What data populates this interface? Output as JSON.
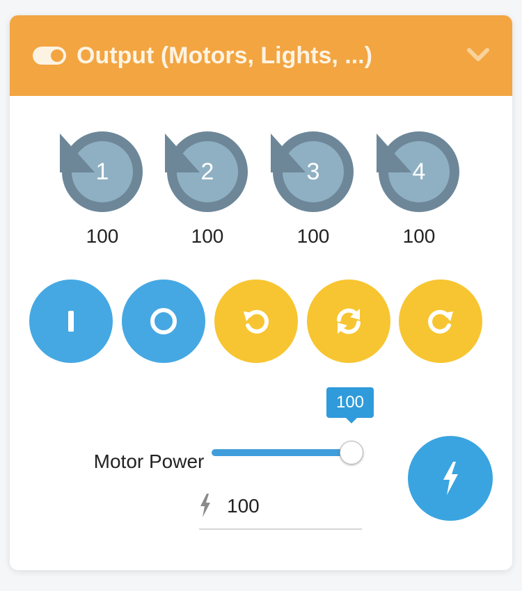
{
  "panel": {
    "title": "Output (Motors, Lights, ...)",
    "accent_color": "#f2a541",
    "icons": {
      "toggle": "toggle-icon",
      "collapse": "chevron-down-icon"
    }
  },
  "ports": [
    {
      "label": "1",
      "value": "100"
    },
    {
      "label": "2",
      "value": "100"
    },
    {
      "label": "3",
      "value": "100"
    },
    {
      "label": "4",
      "value": "100"
    }
  ],
  "controls": [
    {
      "name": "on",
      "icon": "power-on-icon",
      "color": "#45a8e2"
    },
    {
      "name": "off",
      "icon": "power-off-icon",
      "color": "#45a8e2"
    },
    {
      "name": "rotate-counterclockwise",
      "icon": "rotate-ccw-icon",
      "color": "#f7c531"
    },
    {
      "name": "toggle-direction",
      "icon": "sync-icon",
      "color": "#f7c531"
    },
    {
      "name": "rotate-clockwise",
      "icon": "rotate-cw-icon",
      "color": "#f7c531"
    }
  ],
  "motor_power": {
    "label": "Motor Power",
    "slider_value": 100,
    "slider_tooltip": "100",
    "input_value": "100",
    "icons": {
      "field": "lightning-icon",
      "action": "lightning-icon"
    }
  }
}
